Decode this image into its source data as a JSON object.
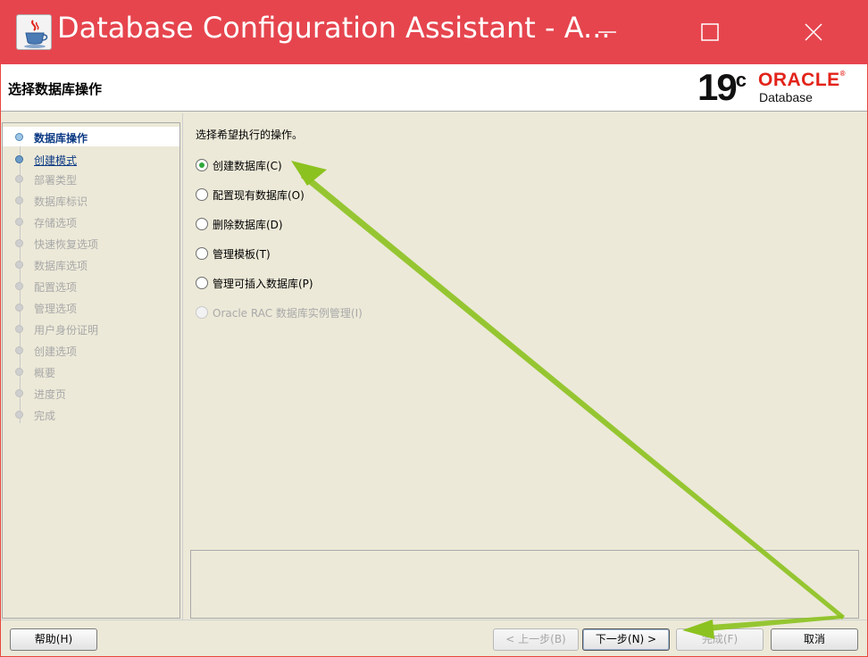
{
  "window": {
    "title": "Database Configuration Assistant - A..."
  },
  "header": {
    "title": "选择数据库操作",
    "logo": {
      "version": "19",
      "version_suffix": "c",
      "brand": "ORACLE",
      "brand_mark": "®",
      "product": "Database"
    }
  },
  "sidebar": {
    "steps": [
      {
        "label": "数据库操作",
        "state": "active"
      },
      {
        "label": "创建模式",
        "state": "link"
      },
      {
        "label": "部署类型",
        "state": "disabled"
      },
      {
        "label": "数据库标识",
        "state": "disabled"
      },
      {
        "label": "存储选项",
        "state": "disabled"
      },
      {
        "label": "快速恢复选项",
        "state": "disabled"
      },
      {
        "label": "数据库选项",
        "state": "disabled"
      },
      {
        "label": "配置选项",
        "state": "disabled"
      },
      {
        "label": "管理选项",
        "state": "disabled"
      },
      {
        "label": "用户身份证明",
        "state": "disabled"
      },
      {
        "label": "创建选项",
        "state": "disabled"
      },
      {
        "label": "概要",
        "state": "disabled"
      },
      {
        "label": "进度页",
        "state": "disabled"
      },
      {
        "label": "完成",
        "state": "disabled"
      }
    ]
  },
  "main": {
    "prompt": "选择希望执行的操作。",
    "options": [
      {
        "label": "创建数据库(C)",
        "checked": true,
        "enabled": true
      },
      {
        "label": "配置现有数据库(O)",
        "checked": false,
        "enabled": true
      },
      {
        "label": "删除数据库(D)",
        "checked": false,
        "enabled": true
      },
      {
        "label": "管理模板(T)",
        "checked": false,
        "enabled": true
      },
      {
        "label": "管理可插入数据库(P)",
        "checked": false,
        "enabled": true
      },
      {
        "label": "Oracle RAC 数据库实例管理(I)",
        "checked": false,
        "enabled": false
      }
    ]
  },
  "footer": {
    "help_label": "帮助(H)",
    "back_label": "< 上一步(B)",
    "next_label": "下一步(N) >",
    "finish_label": "完成(F)",
    "cancel_label": "取消"
  },
  "colors": {
    "titlebar": "#e6454e",
    "accent_link": "#0c3a84",
    "annotation_arrow": "#8cc21f",
    "radio_selected": "#2fa83a",
    "oracle_red": "#e2231a"
  },
  "icons": {
    "app": "java-coffee-cup-icon",
    "minimize": "minimize-icon",
    "maximize": "maximize-icon",
    "close": "close-icon"
  }
}
